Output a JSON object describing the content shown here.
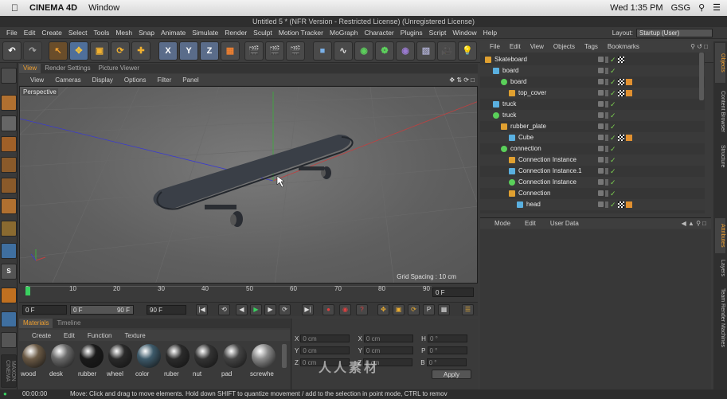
{
  "mac_menubar": {
    "app": "CINEMA 4D",
    "window_menu": "Window",
    "clock": "Wed 1:35 PM",
    "user": "GSG"
  },
  "title": "Untitled 5 * (NFR Version - Restricted License) (Unregistered License)",
  "menu": [
    "File",
    "Edit",
    "Create",
    "Select",
    "Tools",
    "Mesh",
    "Snap",
    "Animate",
    "Simulate",
    "Render",
    "Sculpt",
    "Motion Tracker",
    "MoGraph",
    "Character",
    "Plugins",
    "Script",
    "Window",
    "Help"
  ],
  "layout": {
    "label": "Layout:",
    "value": "Startup (User)"
  },
  "viewport": {
    "tabs": [
      "View",
      "Render Settings",
      "Picture Viewer"
    ],
    "menu": [
      "View",
      "Cameras",
      "Display",
      "Options",
      "Filter",
      "Panel"
    ],
    "label": "Perspective",
    "grid_spacing": "Grid Spacing : 10 cm"
  },
  "timeline": {
    "ticks": [
      "0",
      "10",
      "20",
      "30",
      "40",
      "50",
      "60",
      "70",
      "80",
      "90"
    ],
    "current_frame": "0 F",
    "start": "0 F",
    "range_field": "0 F",
    "range_end": "90 F",
    "end": "90 F",
    "right_field": "0 F"
  },
  "materials": {
    "tabs": [
      "Materials",
      "Timeline"
    ],
    "menu": [
      "Create",
      "Edit",
      "Function",
      "Texture"
    ],
    "items": [
      {
        "label": "wood",
        "color": "#6b5a45"
      },
      {
        "label": "desk",
        "color": "#6a6a6a"
      },
      {
        "label": "rubber",
        "color": "#1a1a1a"
      },
      {
        "label": "wheel",
        "color": "#2a2a2a"
      },
      {
        "label": "color",
        "color": "#3d5a6a"
      },
      {
        "label": "ruber",
        "color": "#2b2b2b"
      },
      {
        "label": "nut",
        "color": "#333333"
      },
      {
        "label": "pad",
        "color": "#444444"
      },
      {
        "label": "screwhe",
        "color": "#8a8a8a"
      }
    ]
  },
  "coords": {
    "rows": [
      {
        "a": "X",
        "av": "0 cm",
        "b": "X",
        "bv": "0 cm",
        "c": "H",
        "cv": "0 °"
      },
      {
        "a": "Y",
        "av": "0 cm",
        "b": "Y",
        "bv": "0 cm",
        "c": "P",
        "cv": "0 °"
      },
      {
        "a": "Z",
        "av": "0 cm",
        "b": "Z",
        "bv": "0 cm",
        "c": "B",
        "cv": "0 °"
      }
    ],
    "apply": "Apply"
  },
  "objects": {
    "menu": [
      "File",
      "Edit",
      "View",
      "Objects",
      "Tags",
      "Bookmarks"
    ],
    "tree": [
      {
        "name": "Skateboard",
        "indent": 0,
        "tags": 1
      },
      {
        "name": "board",
        "indent": 1,
        "tags": 0
      },
      {
        "name": "board",
        "indent": 2,
        "tags": 2
      },
      {
        "name": "top_cover",
        "indent": 3,
        "tags": 2
      },
      {
        "name": "truck",
        "indent": 1,
        "tags": 0
      },
      {
        "name": "truck",
        "indent": 1,
        "tags": 0
      },
      {
        "name": "rubber_plate",
        "indent": 2,
        "tags": 0
      },
      {
        "name": "Cube",
        "indent": 3,
        "tags": 2
      },
      {
        "name": "connection",
        "indent": 2,
        "tags": 0
      },
      {
        "name": "Connection Instance",
        "indent": 3,
        "tags": 0
      },
      {
        "name": "Connection Instance.1",
        "indent": 3,
        "tags": 0
      },
      {
        "name": "Connection Instance",
        "indent": 3,
        "tags": 0
      },
      {
        "name": "Connection",
        "indent": 3,
        "tags": 0
      },
      {
        "name": "head",
        "indent": 4,
        "tags": 2
      }
    ]
  },
  "attributes": {
    "menu": [
      "Mode",
      "Edit",
      "User Data"
    ]
  },
  "right_tabs": [
    "Objects",
    "Content Browser",
    "Structure",
    "Attributes",
    "Layers",
    "Team Render Machines"
  ],
  "status": {
    "time": "00:00:00",
    "message": "Move: Click and drag to move elements. Hold down SHIFT to quantize movement / add to the selection in point mode, CTRL to remov"
  },
  "watermark": "人人素材"
}
